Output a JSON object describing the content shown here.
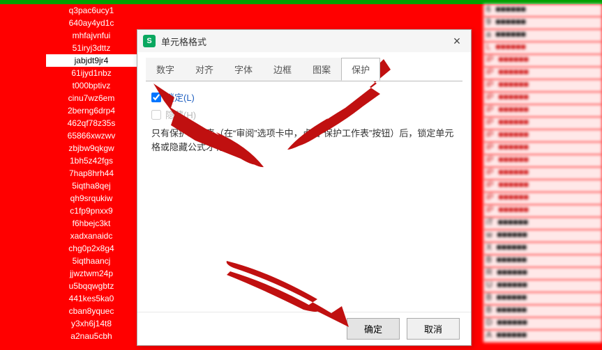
{
  "left_list": {
    "items": [
      "q3pac6ucy1",
      "640ay4yd1c",
      "mhfajvnfui",
      "51iryj3dttz",
      "jabjdt9jr4",
      "61ijyd1nbz",
      "t000bptivz",
      "cinu7wz6em",
      "2berng6drp4",
      "462qf78z35s",
      "65866xwzwv",
      "zbjbw9qkgw",
      "1bh5z42fgs",
      "7hap8hrh44",
      "5iqtha8qej",
      "qh9srqukiw",
      "c1fp9pnxx9",
      "f6hbejc3kt",
      "xadxanaidc",
      "chg0p2x8g4",
      "5iqthaancj",
      "jjwztwm24p",
      "u5bqqwgbtz",
      "441kes5ka0",
      "cban8yquec",
      "y3xh6j14t8",
      "a2nau5cbh"
    ],
    "selected_index": 4
  },
  "right_list": {
    "items": [
      "6",
      "9",
      "a",
      "L",
      "iP",
      "iP",
      "iP",
      "iP",
      "iP",
      "iP",
      "iP",
      "iP",
      "iP",
      "iP",
      "iP",
      "iP",
      "iP",
      "iT",
      "w",
      "X",
      "B",
      "R",
      "U",
      "B",
      "B",
      "D",
      "A"
    ]
  },
  "dialog": {
    "title": "单元格格式",
    "tabs": [
      "数字",
      "对齐",
      "字体",
      "边框",
      "图案",
      "保护"
    ],
    "active_tab_index": 5,
    "protect": {
      "lock_label": "锁定(L)",
      "lock_checked": true,
      "hide_label": "隐藏(H)",
      "hide_checked": false,
      "description": "只有保护工作表（在“审阅”选项卡中，点击“保护工作表”按钮）后，锁定单元格或隐藏公式才有效。"
    },
    "buttons": {
      "ok": "确定",
      "cancel": "取消"
    }
  }
}
